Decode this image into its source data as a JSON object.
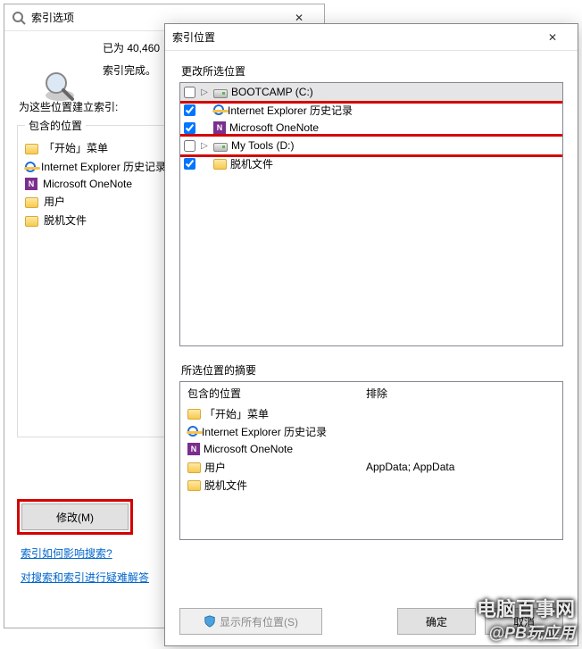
{
  "back": {
    "title": "索引选项",
    "count_line": "已为 40,460",
    "status_line": "索引完成。",
    "label_for_locations": "为这些位置建立索引:",
    "group_title": "包含的位置",
    "locations": [
      {
        "icon": "folder",
        "label": "「开始」菜单"
      },
      {
        "icon": "ie",
        "label": "Internet Explorer 历史记录"
      },
      {
        "icon": "onenote",
        "label": "Microsoft OneNote"
      },
      {
        "icon": "folder",
        "label": "用户"
      },
      {
        "icon": "folder",
        "label": "脱机文件"
      }
    ],
    "modify_btn": "修改(M)",
    "link1": "索引如何影响搜索?",
    "link2": "对搜索和索引进行疑难解答"
  },
  "front": {
    "title": "索引位置",
    "change_label": "更改所选位置",
    "tree": [
      {
        "checked": false,
        "expand": true,
        "icon": "drive",
        "label": "BOOTCAMP (C:)",
        "selected": true,
        "red": true
      },
      {
        "checked": true,
        "expand": false,
        "icon": "ie",
        "label": "Internet Explorer 历史记录"
      },
      {
        "checked": true,
        "expand": false,
        "icon": "onenote",
        "label": "Microsoft OneNote"
      },
      {
        "checked": false,
        "expand": true,
        "icon": "drive",
        "label": "My Tools (D:)",
        "red": true
      },
      {
        "checked": true,
        "expand": false,
        "icon": "folder",
        "label": "脱机文件"
      }
    ],
    "summary_label": "所选位置的摘要",
    "summary_head_col1": "包含的位置",
    "summary_head_col2": "排除",
    "summary_rows": [
      {
        "icon": "folder",
        "label": "「开始」菜单",
        "exclude": ""
      },
      {
        "icon": "ie",
        "label": "Internet Explorer 历史记录",
        "exclude": ""
      },
      {
        "icon": "onenote",
        "label": "Microsoft OneNote",
        "exclude": ""
      },
      {
        "icon": "folder",
        "label": "用户",
        "exclude": "AppData; AppData"
      },
      {
        "icon": "folder",
        "label": "脱机文件",
        "exclude": ""
      }
    ],
    "show_all_btn": "显示所有位置(S)",
    "ok_btn": "确定",
    "cancel_btn": "取消"
  },
  "watermark_top": "电脑百事网",
  "watermark_bottom": "@PB玩应用"
}
